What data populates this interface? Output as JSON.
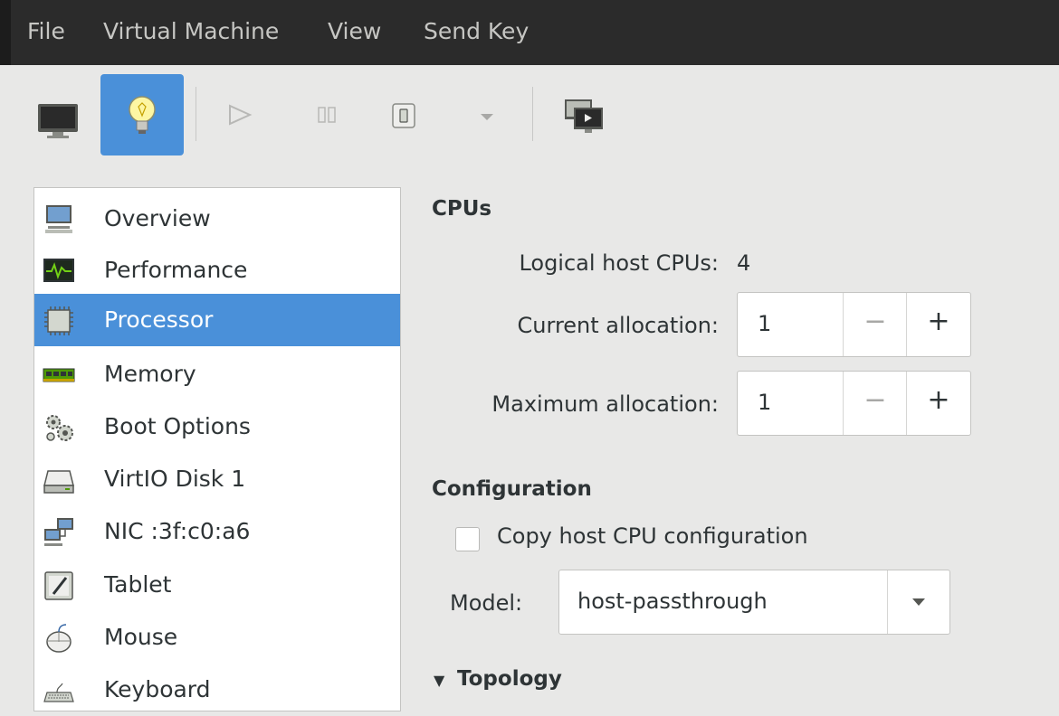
{
  "menubar": {
    "items": [
      "File",
      "Virtual Machine",
      "View",
      "Send Key"
    ]
  },
  "toolbar": {
    "buttons": [
      {
        "icon": "console-monitor-icon",
        "active": false
      },
      {
        "icon": "details-lightbulb-icon",
        "active": true
      },
      {
        "icon": "play-icon",
        "active": false
      },
      {
        "icon": "pause-icon",
        "active": false
      },
      {
        "icon": "shutdown-icon",
        "active": false
      },
      {
        "icon": "dropdown-arrow-icon",
        "active": false
      },
      {
        "icon": "fullscreen-screens-icon",
        "active": false
      }
    ]
  },
  "sidebar": {
    "items": [
      {
        "label": "Overview",
        "icon": "computer-icon"
      },
      {
        "label": "Performance",
        "icon": "performance-monitor-icon"
      },
      {
        "label": "Processor",
        "icon": "cpu-chip-icon",
        "selected": true
      },
      {
        "label": "Memory",
        "icon": "memory-ram-icon"
      },
      {
        "label": "Boot Options",
        "icon": "gears-icon"
      },
      {
        "label": "VirtIO Disk 1",
        "icon": "hard-disk-icon"
      },
      {
        "label": "NIC :3f:c0:a6",
        "icon": "network-icon"
      },
      {
        "label": "Tablet",
        "icon": "tablet-icon"
      },
      {
        "label": "Mouse",
        "icon": "mouse-icon"
      },
      {
        "label": "Keyboard",
        "icon": "keyboard-icon"
      }
    ]
  },
  "cpus": {
    "title": "CPUs",
    "logical_label": "Logical host CPUs:",
    "logical_value": "4",
    "current_label": "Current allocation:",
    "current_value": "1",
    "maximum_label": "Maximum allocation:",
    "maximum_value": "1",
    "minus": "−",
    "plus": "+"
  },
  "configuration": {
    "title": "Configuration",
    "copy_host_label": "Copy host CPU configuration",
    "copy_host_checked": false,
    "model_label": "Model:",
    "model_value": "host-passthrough"
  },
  "topology": {
    "title": "Topology",
    "expander": "▼"
  },
  "colors": {
    "accent": "#4a90d9",
    "menubar_bg": "#2b2b2b",
    "window_bg": "#e8e8e7"
  }
}
